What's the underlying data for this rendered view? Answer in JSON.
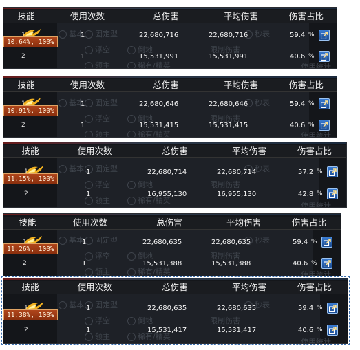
{
  "columns": {
    "skill": "技能",
    "uses": "使用次数",
    "total": "总伤害",
    "avg": "平均伤害",
    "share": "伤害占比"
  },
  "ghost": {
    "basic": "基本",
    "fixed": "固定型",
    "float": "浮空",
    "down": "倒地",
    "boss": "领主",
    "elite": "稀有/精英",
    "seconds": "秒表",
    "limit": "限制伤害",
    "use_stats": "使用统计"
  },
  "icons": {
    "skill": "flame-icon",
    "export": "export-icon"
  },
  "colors": {
    "badge": "#b0461c",
    "button": "#2f6bc0"
  },
  "panels": [
    {
      "badge": "10.64%, 100%",
      "rows": [
        {
          "idx": "1",
          "uses": "1",
          "total": "22,680,716",
          "avg": "22,680,716",
          "share": "59.4",
          "unit": "%"
        },
        {
          "idx": "2",
          "uses": "1",
          "total": "15,531,991",
          "avg": "15,531,991",
          "share": "40.6",
          "unit": "%"
        }
      ]
    },
    {
      "badge": "10.91%, 100%",
      "rows": [
        {
          "idx": "1",
          "uses": "1",
          "total": "22,680,646",
          "avg": "22,680,646",
          "share": "59.4",
          "unit": "%"
        },
        {
          "idx": "2",
          "uses": "1",
          "total": "15,531,415",
          "avg": "15,531,415",
          "share": "40.6",
          "unit": "%"
        }
      ]
    },
    {
      "badge": "11.15%, 100%",
      "rows": [
        {
          "idx": "1",
          "uses": "1",
          "total": "22,680,714",
          "avg": "22,680,714",
          "share": "57.2",
          "unit": "%"
        },
        {
          "idx": "2",
          "uses": "1",
          "total": "16,955,130",
          "avg": "16,955,130",
          "share": "42.8",
          "unit": "%"
        }
      ]
    },
    {
      "badge": "11.26%, 100%",
      "rows": [
        {
          "idx": "1",
          "uses": "1",
          "total": "22,680,635",
          "avg": "22,680,635",
          "share": "59.4",
          "unit": "%"
        },
        {
          "idx": "2",
          "uses": "1",
          "total": "15,531,388",
          "avg": "15,531,388",
          "share": "40.6",
          "unit": "%"
        }
      ]
    },
    {
      "badge": "11.38%, 100%",
      "rows": [
        {
          "idx": "1",
          "uses": "1",
          "total": "22,680,635",
          "avg": "22,680,635",
          "share": "59.4",
          "unit": "%"
        },
        {
          "idx": "2",
          "uses": "1",
          "total": "15,531,417",
          "avg": "15,531,417",
          "share": "40.6",
          "unit": "%"
        }
      ]
    }
  ]
}
